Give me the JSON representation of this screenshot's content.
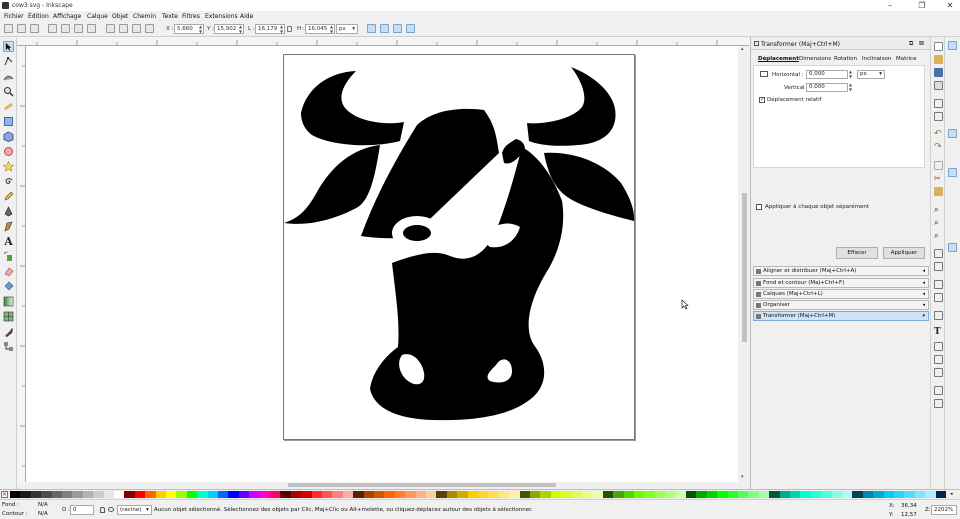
{
  "window": {
    "title": "cow3.svg - Inkscape",
    "minimize": "–",
    "maximize": "❐",
    "close": "✕"
  },
  "menu": [
    "Fichier",
    "Édition",
    "Affichage",
    "Calque",
    "Objet",
    "Chemin",
    "Texte",
    "Filtres",
    "Extensions",
    "Aide"
  ],
  "toolbar": {
    "x_label": "X :",
    "x_value": "5,660",
    "y_label": "Y :",
    "y_value": "15,902",
    "w_label": "L :",
    "w_value": "16,179",
    "h_label": "H :",
    "h_value": "16,045",
    "unit": "px"
  },
  "dock": {
    "panel_title": "Transformer (Maj+Ctrl+M)",
    "tabs": [
      "Déplacement",
      "Dimensions",
      "Rotation",
      "Inclinaison",
      "Matrice"
    ],
    "horizontal_label": "Horizontal :",
    "horizontal_value": "0,000",
    "vertical_label": "Vertical :",
    "vertical_value": "0,000",
    "unit": "px",
    "relative_label": "Déplacement relatif",
    "apply_separately_label": "Appliquer à chaque objet séparément",
    "clear_button": "Effacer",
    "apply_button": "Appliquer",
    "collapsed_panels": [
      "Aligner et distribuer (Maj+Ctrl+A)",
      "Fond et contour (Maj+Ctrl+F)",
      "Calques (Maj+Ctrl+L)",
      "Organiser",
      "Transformer (Maj+Ctrl+M)"
    ]
  },
  "status": {
    "fill_label": "Fond :",
    "fill_value": "N/A",
    "stroke_label": "Contour :",
    "stroke_value": "N/A",
    "opacity_label": "O :",
    "opacity_value": "0",
    "layer": "(racine)",
    "message": "Aucun objet sélectionné. Sélectionnez des objets par Clic, Maj+Clic ou Alt+molette, ou cliquez-déplacez autour des objets à sélectionner.",
    "x_label": "X:",
    "x_value": "36,34",
    "y_label": "Y:",
    "y_value": "12,57",
    "zoom_label": "Z:",
    "zoom_value": "2202%"
  },
  "colors": {
    "accent": "#3a78c3",
    "canvas_bg": "#ffffff",
    "drawing_fill": "#000000"
  },
  "palette": [
    "#000000",
    "#1a1a1a",
    "#333333",
    "#4d4d4d",
    "#666666",
    "#808080",
    "#999999",
    "#b3b3b3",
    "#cccccc",
    "#e6e6e6",
    "#ffffff",
    "#800000",
    "#ff0000",
    "#ff6600",
    "#ffcc00",
    "#ffff00",
    "#99ff00",
    "#00ff00",
    "#00ffcc",
    "#00ccff",
    "#0066ff",
    "#0000ff",
    "#6600ff",
    "#cc00ff",
    "#ff00cc",
    "#ff0066",
    "#550000",
    "#aa0000",
    "#d40000",
    "#ff2a2a",
    "#ff5555",
    "#ff8080",
    "#ffaaaa",
    "#552200",
    "#aa4400",
    "#d45500",
    "#ff6600",
    "#ff7f2a",
    "#ff9955",
    "#ffb380",
    "#ffccaa",
    "#554400",
    "#aa8800",
    "#d4aa00",
    "#ffcc00",
    "#ffd42a",
    "#ffdd55",
    "#ffe680",
    "#ffeeaa",
    "#445500",
    "#88aa00",
    "#aad400",
    "#ccff00",
    "#d4ff2a",
    "#ddff55",
    "#e5ff80",
    "#eeffaa",
    "#225500",
    "#44aa00",
    "#55d400",
    "#66ff00",
    "#7fff2a",
    "#99ff55",
    "#b3ff80",
    "#ccffaa",
    "#005500",
    "#00aa00",
    "#00d400",
    "#00ff00",
    "#2aff2a",
    "#55ff55",
    "#80ff80",
    "#aaffaa",
    "#005544",
    "#00aa88",
    "#00d4aa",
    "#00ffcc",
    "#2affd5",
    "#55ffdd",
    "#80ffe6",
    "#aaffee",
    "#004455",
    "#0088aa",
    "#00aad4",
    "#00ccff",
    "#2ad4ff",
    "#55ddff",
    "#80e5ff",
    "#aaeeff",
    "#002255"
  ],
  "icons": {
    "tools": [
      "selector-icon",
      "node-icon",
      "tweak-icon",
      "zoom-icon",
      "measure-icon",
      "rect-icon",
      "box3d-icon",
      "ellipse-icon",
      "star-icon",
      "spiral-icon",
      "pencil-icon",
      "pen-icon",
      "calligraphy-icon",
      "text-icon",
      "spray-icon",
      "eraser-icon",
      "bucket-icon",
      "gradient-icon",
      "mesh-icon",
      "dropper-icon",
      "connector-icon"
    ]
  }
}
